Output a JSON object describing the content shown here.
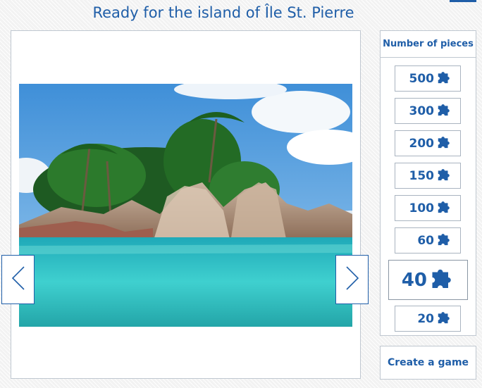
{
  "page": {
    "title": "Ready for the island of Île St. Pierre"
  },
  "gallery": {
    "prev_icon": "chevron-left-icon",
    "next_icon": "chevron-right-icon"
  },
  "pieces": {
    "header": "Number of pieces",
    "options": [
      "500",
      "300",
      "200",
      "150",
      "100",
      "60",
      "40",
      "20"
    ],
    "selected": "40",
    "icon": "puzzle-piece-icon"
  },
  "actions": {
    "create_label": "Create a game"
  },
  "colors": {
    "accent": "#1f5ea8",
    "border": "#bfc7d0"
  }
}
